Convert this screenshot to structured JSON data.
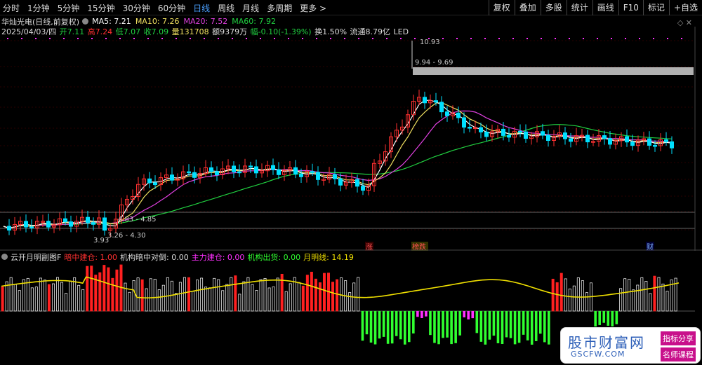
{
  "toolbar": {
    "periods": [
      "分时",
      "1分钟",
      "5分钟",
      "15分钟",
      "30分钟",
      "60分钟",
      "日线",
      "周线",
      "月线",
      "多周期",
      "更多 >"
    ],
    "active_index": 6,
    "right_buttons": [
      "复权",
      "叠加",
      "多股",
      "统计",
      "画线",
      "F10",
      "标记",
      "+自选"
    ]
  },
  "stock": {
    "name": "华灿光电(日线,前复权)",
    "ma5": "MA5: 7.21",
    "ma10": "MA10: 7.26",
    "ma20": "MA20: 7.52",
    "ma60": "MA60: 7.92",
    "date": "2025/04/03/四",
    "open": "开7.11",
    "high": "高7.24",
    "low": "低7.07",
    "close": "收7.09",
    "vol": "量131708",
    "amount": "额9379万",
    "change": "幅-0.10(-1.39%)",
    "turnover": "换1.50%",
    "float": "流通8.79亿",
    "led": "LED"
  },
  "annotations": {
    "high_label": "10.93",
    "high_range": "9.94 - 9.69",
    "mid_range": "4.83 - 4.85",
    "low_range": "3.26 - 4.30",
    "low_label": "3.93",
    "tag_zhang": "涨",
    "tag_bangdie": "榜跌",
    "tag_cai": "财"
  },
  "indicator": {
    "name": "云开月明副图F",
    "l1": "暗中建仓: 1.00",
    "l2": "机构暗中对倒: 0.00",
    "l3": "主力建仓: 0.00",
    "l4": "机构出货: 0.00",
    "l5": "月明线: 14.19"
  },
  "colors": {
    "up": "#ff3030",
    "down": "#00e0ff",
    "ma5": "#ffffff",
    "ma10": "#f0e060",
    "ma20": "#e040e0",
    "ma60": "#20d040",
    "yellow_line": "#f0e000",
    "bar_red": "#ff2020",
    "bar_white": "#e8e8e8",
    "bar_green": "#30ff30",
    "bar_magenta": "#ff30ff"
  },
  "watermark": {
    "cn": "股市财富网",
    "en": "GSCFW.COM",
    "tag1": "指标分享",
    "tag2": "名师课程"
  }
}
